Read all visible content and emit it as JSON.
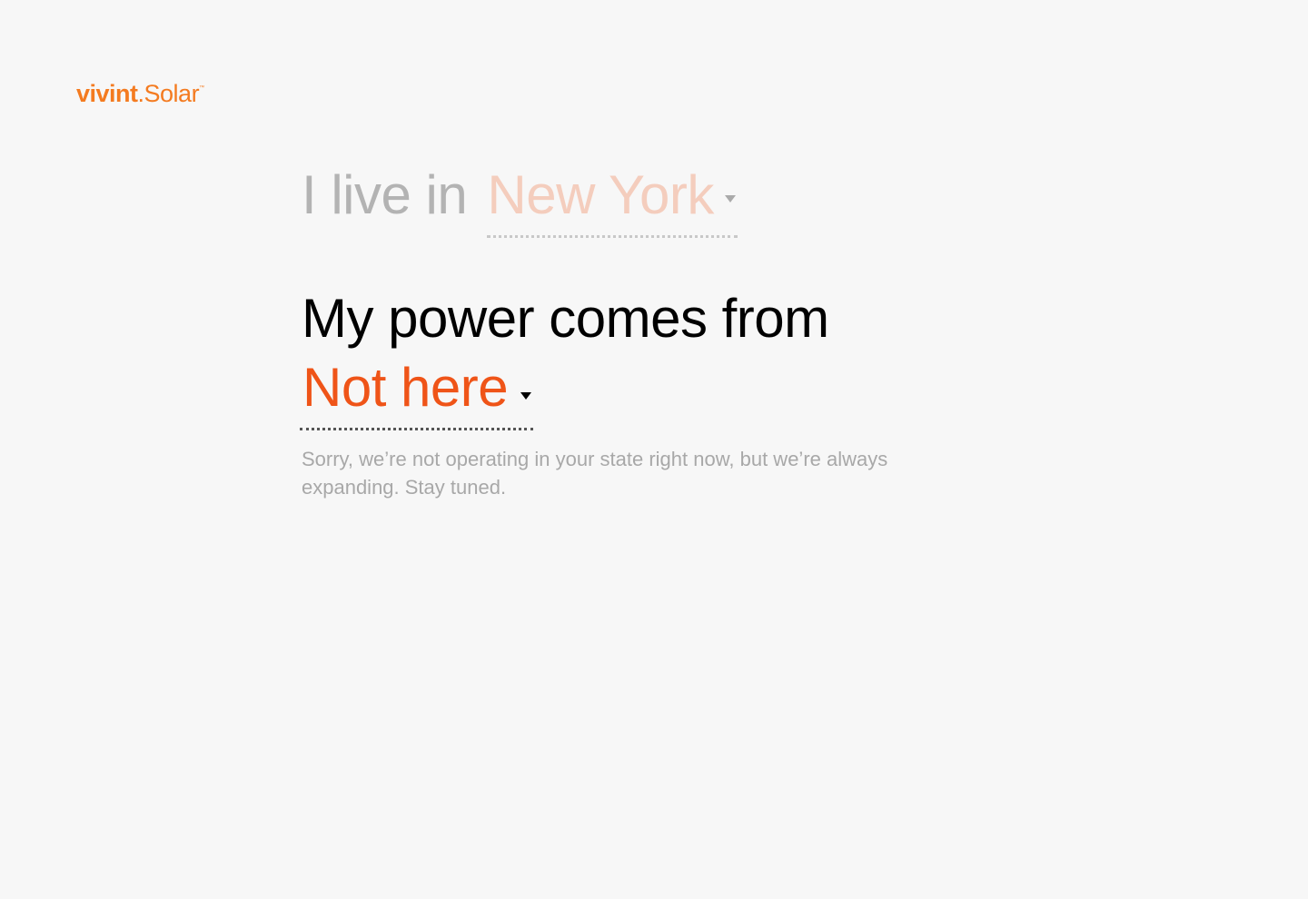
{
  "brand": {
    "logo_bold": "vivint",
    "logo_rest": ".Solar",
    "logo_tm": "™",
    "color": "#f47b20"
  },
  "state_question": {
    "prefix": "I live in",
    "selected": "New York",
    "icon": "caret-down-icon"
  },
  "power_question": {
    "prefix": "My power comes from",
    "selected": "Not here",
    "icon": "caret-down-icon",
    "accent": "#ef5418"
  },
  "message": "Sorry, we’re not operating in your state right now, but we’re always expanding. Stay tuned."
}
